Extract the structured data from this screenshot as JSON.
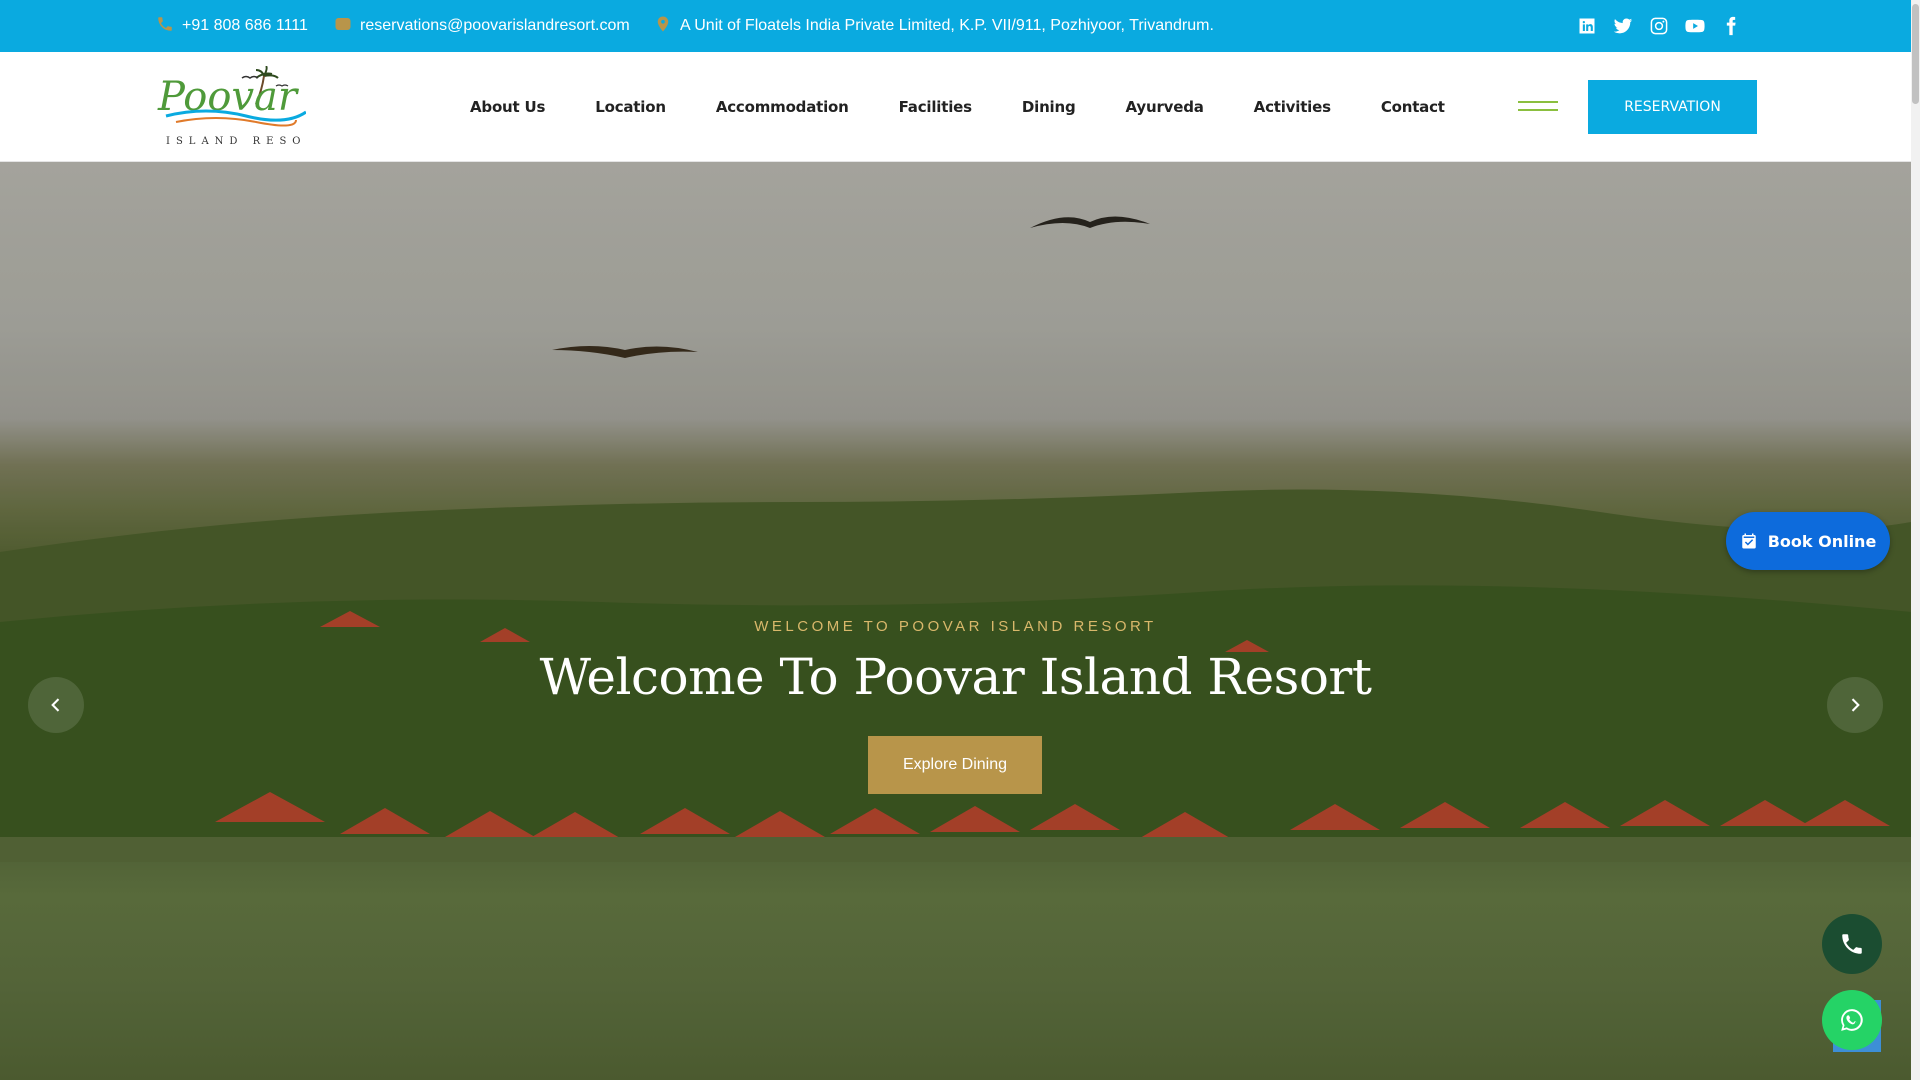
{
  "topbar": {
    "phone": "+91 808 686 1111",
    "email": "reservations@poovarislandresort.com",
    "address": "A Unit of Floatels India Private Limited, K.P. VII/911, Pozhiyoor, Trivandrum.",
    "social": [
      "linkedin-icon",
      "twitter-icon",
      "instagram-icon",
      "youtube-icon",
      "facebook-icon"
    ]
  },
  "logo": {
    "name": "Poovar",
    "tagline": "ISLAND RESORT"
  },
  "nav": {
    "items": [
      "About Us",
      "Location",
      "Accommodation",
      "Facilities",
      "Dining",
      "Ayurveda",
      "Activities",
      "Contact"
    ],
    "reservation_label": "RESERVATION"
  },
  "hero": {
    "subtitle": "WELCOME TO POOVAR ISLAND RESORT",
    "title": "Welcome To Poovar Island Resort",
    "button_label": "Explore Dining"
  },
  "floating": {
    "book_online_label": "Book Online"
  },
  "colors": {
    "brand_blue": "#0aaae0",
    "gold": "#b8954a",
    "book_blue": "#0d6bdc",
    "call_green": "#1b4d31",
    "whatsapp_green": "#25d366"
  }
}
